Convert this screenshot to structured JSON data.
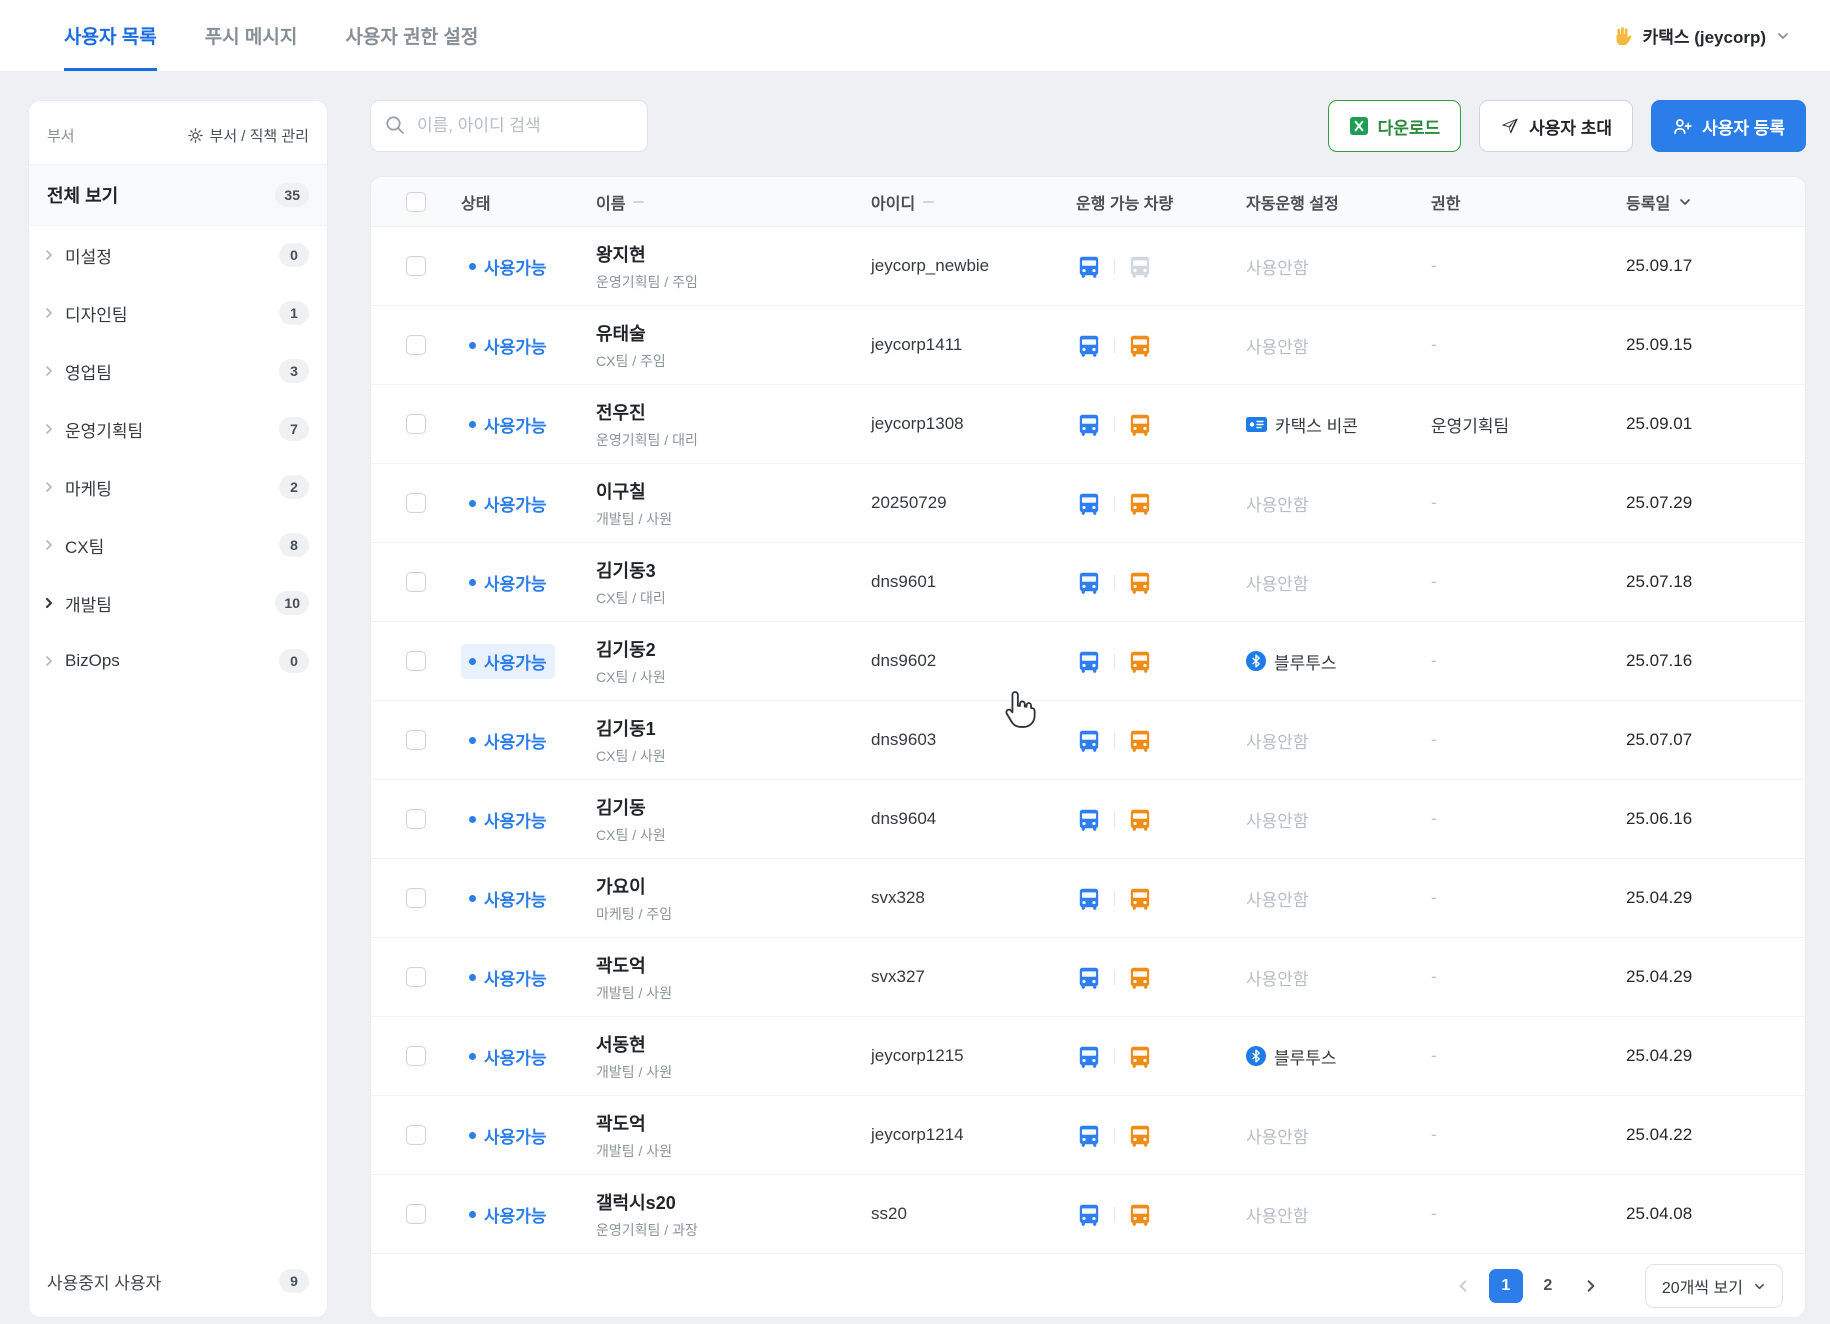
{
  "topnav": {
    "tabs": [
      {
        "label": "사용자 목록",
        "active": true
      },
      {
        "label": "푸시 메시지",
        "active": false
      },
      {
        "label": "사용자 권한 설정",
        "active": false
      }
    ],
    "workspace": {
      "label": "카택스 (jeycorp)"
    }
  },
  "sidebar": {
    "title": "부서",
    "manage_link": "부서 / 직책 관리",
    "all_view": {
      "label": "전체 보기",
      "count": "35"
    },
    "items": [
      {
        "label": "미설정",
        "count": "0"
      },
      {
        "label": "디자인팀",
        "count": "1"
      },
      {
        "label": "영업팀",
        "count": "3"
      },
      {
        "label": "운영기획팀",
        "count": "7"
      },
      {
        "label": "마케팅",
        "count": "2"
      },
      {
        "label": "CX팀",
        "count": "8"
      },
      {
        "label": "개발팀",
        "count": "10",
        "emphasis": true
      },
      {
        "label": "BizOps",
        "count": "0"
      }
    ],
    "suspended": {
      "label": "사용중지 사용자",
      "count": "9"
    }
  },
  "toolbar": {
    "search_placeholder": "이름, 아이디 검색",
    "download": "다운로드",
    "invite": "사용자 초대",
    "register": "사용자 등록"
  },
  "table": {
    "headers": {
      "status": "상태",
      "name": "이름",
      "id": "아이디",
      "vehicles": "운행 가능 차량",
      "autodrive": "자동운행 설정",
      "permission": "권한",
      "date": "등록일"
    },
    "rows": [
      {
        "status": "사용가능",
        "name": "왕지현",
        "dept": "운영기획팀 / 주임",
        "id": "jeycorp_newbie",
        "car2": "gray",
        "auto": "사용안함",
        "auto_type": "none",
        "perm": "-",
        "date": "25.09.17"
      },
      {
        "status": "사용가능",
        "name": "유태술",
        "dept": "CX팀 / 주임",
        "id": "jeycorp1411",
        "car2": "orange",
        "auto": "사용안함",
        "auto_type": "none",
        "perm": "-",
        "date": "25.09.15"
      },
      {
        "status": "사용가능",
        "name": "전우진",
        "dept": "운영기획팀 / 대리",
        "id": "jeycorp1308",
        "car2": "orange",
        "auto": "카택스 비콘",
        "auto_type": "beacon",
        "perm": "운영기획팀",
        "date": "25.09.01"
      },
      {
        "status": "사용가능",
        "name": "이구칠",
        "dept": "개발팀 / 사원",
        "id": "20250729",
        "car2": "orange",
        "auto": "사용안함",
        "auto_type": "none",
        "perm": "-",
        "date": "25.07.29"
      },
      {
        "status": "사용가능",
        "name": "김기동3",
        "dept": "CX팀 / 대리",
        "id": "dns9601",
        "car2": "orange",
        "auto": "사용안함",
        "auto_type": "none",
        "perm": "-",
        "date": "25.07.18"
      },
      {
        "status": "사용가능",
        "name": "김기동2",
        "dept": "CX팀 / 사원",
        "id": "dns9602",
        "car2": "orange",
        "auto": "블루투스",
        "auto_type": "bluetooth",
        "perm": "-",
        "date": "25.07.16",
        "status_hl": true
      },
      {
        "status": "사용가능",
        "name": "김기동1",
        "dept": "CX팀 / 사원",
        "id": "dns9603",
        "car2": "orange",
        "auto": "사용안함",
        "auto_type": "none",
        "perm": "-",
        "date": "25.07.07"
      },
      {
        "status": "사용가능",
        "name": "김기동",
        "dept": "CX팀 / 사원",
        "id": "dns9604",
        "car2": "orange",
        "auto": "사용안함",
        "auto_type": "none",
        "perm": "-",
        "date": "25.06.16"
      },
      {
        "status": "사용가능",
        "name": "가요이",
        "dept": "마케팅 / 주임",
        "id": "svx328",
        "car2": "orange",
        "auto": "사용안함",
        "auto_type": "none",
        "perm": "-",
        "date": "25.04.29"
      },
      {
        "status": "사용가능",
        "name": "곽도억",
        "dept": "개발팀 / 사원",
        "id": "svx327",
        "car2": "orange",
        "auto": "사용안함",
        "auto_type": "none",
        "perm": "-",
        "date": "25.04.29"
      },
      {
        "status": "사용가능",
        "name": "서동현",
        "dept": "개발팀 / 사원",
        "id": "jeycorp1215",
        "car2": "orange",
        "auto": "블루투스",
        "auto_type": "bluetooth",
        "perm": "-",
        "date": "25.04.29"
      },
      {
        "status": "사용가능",
        "name": "곽도억",
        "dept": "개발팀 / 사원",
        "id": "jeycorp1214",
        "car2": "orange",
        "auto": "사용안함",
        "auto_type": "none",
        "perm": "-",
        "date": "25.04.22"
      },
      {
        "status": "사용가능",
        "name": "갤럭시s20",
        "dept": "운영기획팀 / 과장",
        "id": "ss20",
        "car2": "orange",
        "auto": "사용안함",
        "auto_type": "none",
        "perm": "-",
        "date": "25.04.08"
      }
    ]
  },
  "pagination": {
    "pages": [
      "1",
      "2"
    ],
    "active_page": "1",
    "page_size": "20개씩 보기"
  },
  "colors": {
    "primary": "#2b7de9",
    "excel_green": "#1e9e53",
    "car_blue": "#2f7ef0",
    "car_orange": "#ef8c16",
    "car_gray": "#d3d8de"
  }
}
